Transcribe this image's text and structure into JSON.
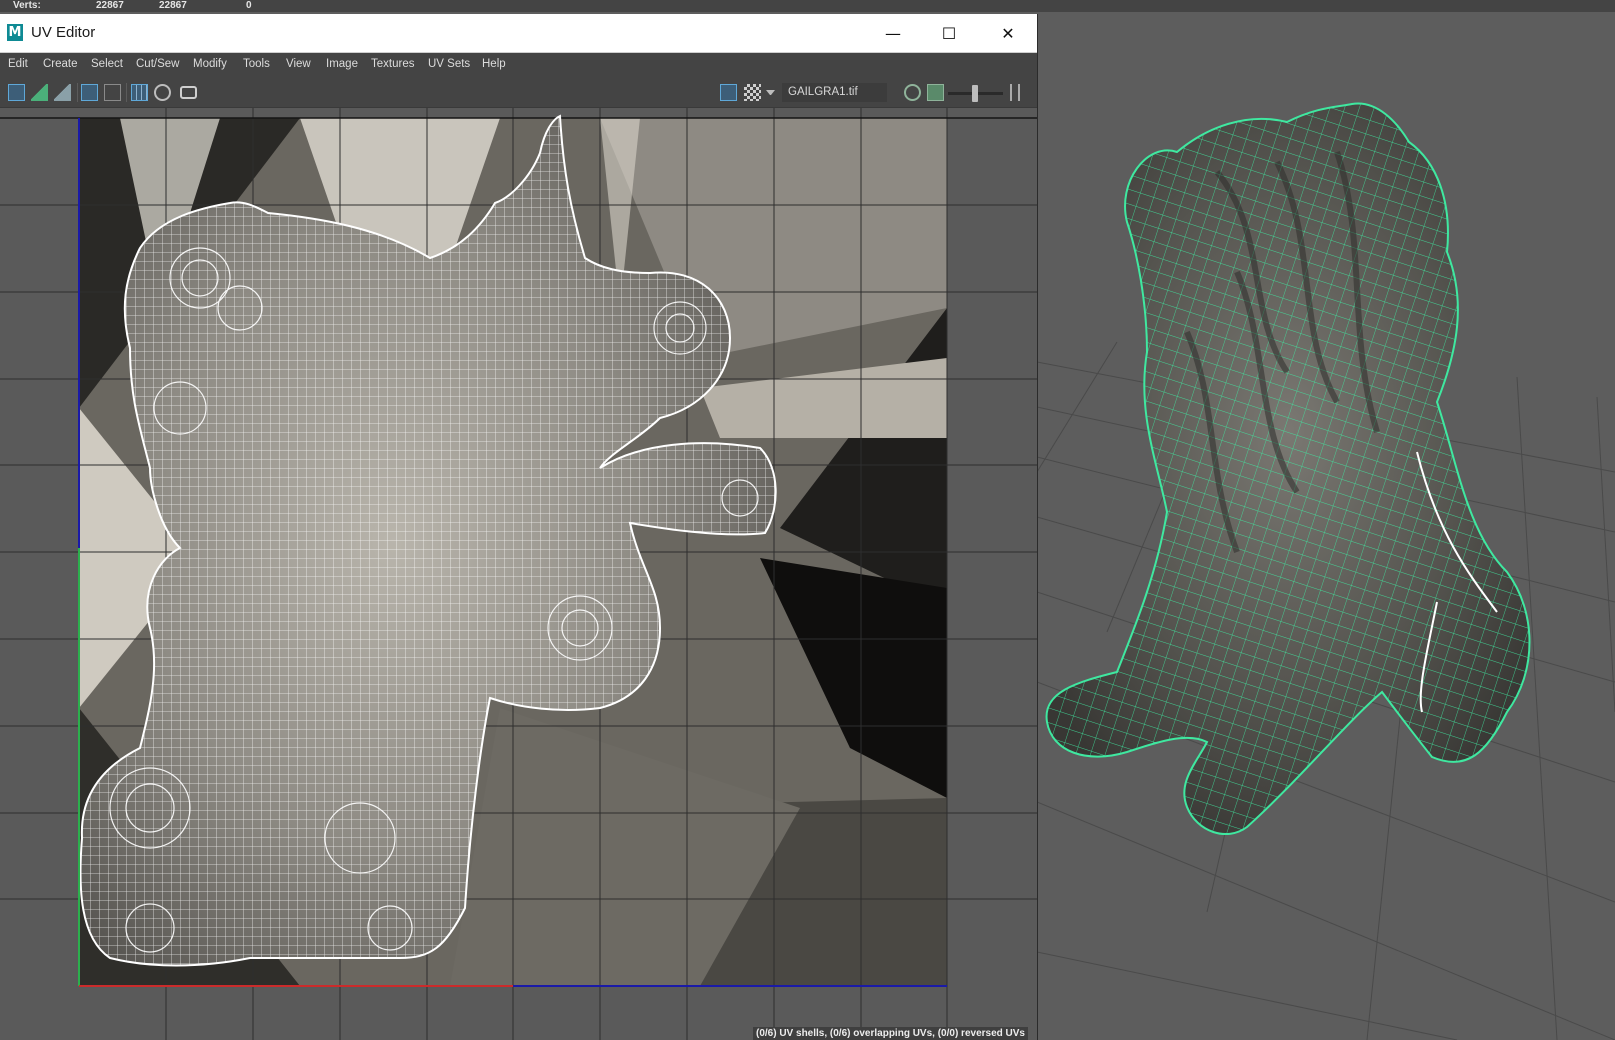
{
  "stats": {
    "label": "Verts:",
    "values": [
      "22867",
      "22867",
      "0"
    ]
  },
  "window": {
    "title": "UV Editor",
    "logo_letter": "M",
    "controls": {
      "minimize": "—",
      "maximize": "☐",
      "close": "✕"
    }
  },
  "menu": [
    "Edit",
    "Create",
    "Select",
    "Cut/Sew",
    "Modify",
    "Tools",
    "View",
    "Image",
    "Textures",
    "UV Sets",
    "Help"
  ],
  "toolbar": {
    "image_name": "GAILGRA1.tif",
    "left_icons": [
      "uv-layout-icon",
      "uv-snapshot-icon",
      "uv-shell-icon",
      "texture-borders-icon",
      "distortion-icon",
      "grid-icon",
      "isolate-icon",
      "camera-icon"
    ],
    "right_icons": [
      "image-display-icon",
      "checker-icon",
      "dropdown-icon",
      "image-ratio-icon",
      "image-filter-icon",
      "zoom-slider",
      "collapse-icon"
    ]
  },
  "status": "(0/6) UV shells, (0/6) overlapping UVs, (0/0) reversed UVs",
  "colors": {
    "wire_uv": "#ffffff",
    "wire_3d": "#3fe8a0",
    "grid": "#2e2e2e",
    "u_axis": "#cc2b2b",
    "v_axis": "#2bb04d",
    "frame_line": "#1a1aa8"
  }
}
